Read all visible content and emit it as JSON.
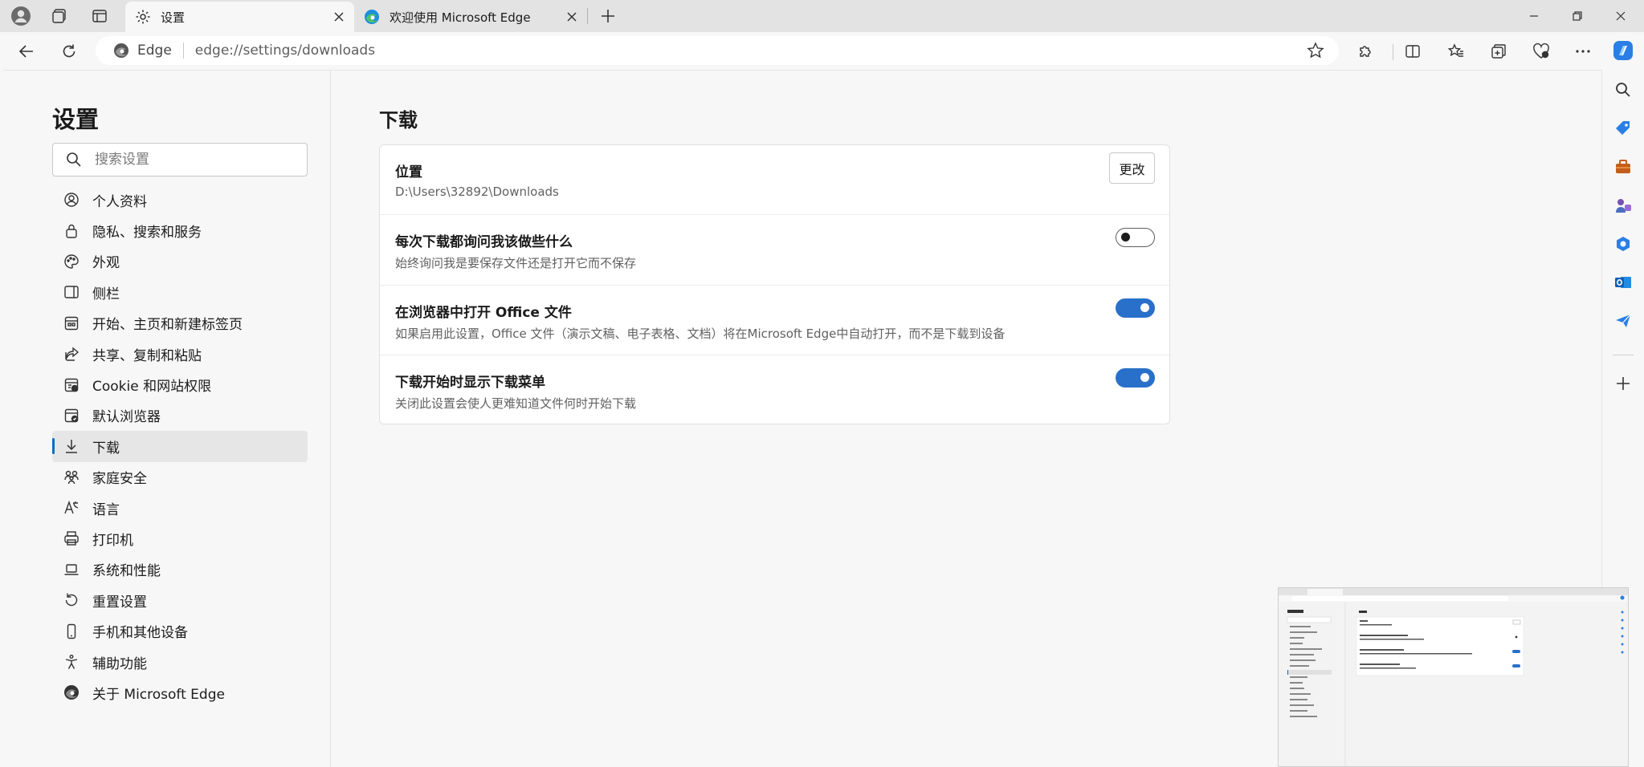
{
  "tabs": [
    {
      "title": "设置",
      "icon": "gear-icon",
      "active": true
    },
    {
      "title": "欢迎使用 Microsoft Edge",
      "icon": "edge-logo-icon",
      "active": false
    }
  ],
  "address": {
    "site_label": "Edge",
    "url": "edge://settings/downloads"
  },
  "sidebar": {
    "title": "设置",
    "search_placeholder": "搜索设置",
    "items": [
      {
        "label": "个人资料",
        "icon": "profile-icon"
      },
      {
        "label": "隐私、搜索和服务",
        "icon": "lock-icon"
      },
      {
        "label": "外观",
        "icon": "appearance-icon"
      },
      {
        "label": "侧栏",
        "icon": "sidebar-icon"
      },
      {
        "label": "开始、主页和新建标签页",
        "icon": "home-icon"
      },
      {
        "label": "共享、复制和粘贴",
        "icon": "share-icon"
      },
      {
        "label": "Cookie 和网站权限",
        "icon": "site-permissions-icon"
      },
      {
        "label": "默认浏览器",
        "icon": "default-browser-icon"
      },
      {
        "label": "下载",
        "icon": "download-icon",
        "selected": true
      },
      {
        "label": "家庭安全",
        "icon": "family-icon"
      },
      {
        "label": "语言",
        "icon": "language-icon"
      },
      {
        "label": "打印机",
        "icon": "printer-icon"
      },
      {
        "label": "系统和性能",
        "icon": "laptop-icon"
      },
      {
        "label": "重置设置",
        "icon": "reset-icon"
      },
      {
        "label": "手机和其他设备",
        "icon": "phone-icon"
      },
      {
        "label": "辅助功能",
        "icon": "accessibility-icon"
      },
      {
        "label": "关于 Microsoft Edge",
        "icon": "edge-logo-icon"
      }
    ]
  },
  "content": {
    "title": "下载",
    "rows": [
      {
        "title": "位置",
        "desc": "D:\\Users\\32892\\Downloads",
        "control": "button",
        "button_label": "更改"
      },
      {
        "title": "每次下载都询问我该做些什么",
        "desc": "始终询问我是要保存文件还是打开它而不保存",
        "control": "toggle",
        "on": false
      },
      {
        "title": "在浏览器中打开 Office 文件",
        "desc": "如果启用此设置，Office 文件（演示文稿、电子表格、文档）将在Microsoft Edge中自动打开，而不是下载到设备",
        "control": "toggle",
        "on": true
      },
      {
        "title": "下载开始时显示下载菜单",
        "desc": "关闭此设置会使人更难知道文件何时开始下载",
        "control": "toggle",
        "on": true
      }
    ]
  },
  "colors": {
    "accent": "#2870c9",
    "selected_indicator": "#0f6cbd"
  }
}
